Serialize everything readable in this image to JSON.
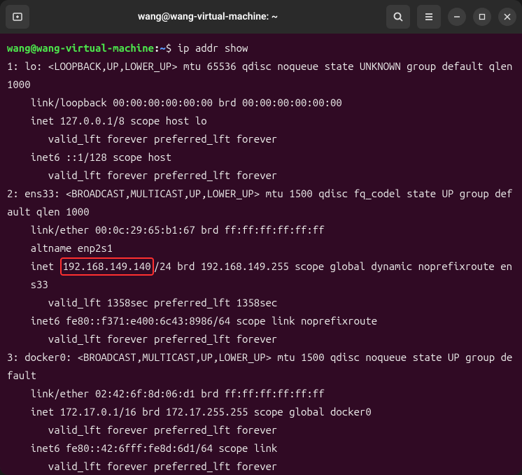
{
  "window": {
    "title": "wang@wang-virtual-machine: ~"
  },
  "prompt": {
    "user": "wang@wang-virtual-machine",
    "separator": ":",
    "path": "~",
    "symbol": "$"
  },
  "command": "ip addr show",
  "highlighted_ip": "192.168.149.140",
  "interfaces": [
    {
      "index": "1",
      "name": "lo",
      "header": "1: lo: <LOOPBACK,UP,LOWER_UP> mtu 65536 qdisc noqueue state UNKNOWN group default qlen 1000",
      "lines": [
        {
          "indent": 1,
          "text": "link/loopback 00:00:00:00:00:00 brd 00:00:00:00:00:00"
        },
        {
          "indent": 1,
          "text": "inet 127.0.0.1/8 scope host lo"
        },
        {
          "indent": 2,
          "text": "valid_lft forever preferred_lft forever"
        },
        {
          "indent": 1,
          "text": "inet6 ::1/128 scope host"
        },
        {
          "indent": 2,
          "text": "valid_lft forever preferred_lft forever"
        }
      ]
    },
    {
      "index": "2",
      "name": "ens33",
      "header": "2: ens33: <BROADCAST,MULTICAST,UP,LOWER_UP> mtu 1500 qdisc fq_codel state UP group default qlen 1000",
      "lines": [
        {
          "indent": 1,
          "text": "link/ether 00:0c:29:65:b1:67 brd ff:ff:ff:ff:ff:ff"
        },
        {
          "indent": 1,
          "text": "altname enp2s1"
        },
        {
          "indent": 1,
          "text_before": "inet ",
          "highlight": "192.168.149.140",
          "text_after": "/24 brd 192.168.149.255 scope global dynamic noprefixroute ens33"
        },
        {
          "indent": 2,
          "text": "valid_lft 1358sec preferred_lft 1358sec"
        },
        {
          "indent": 1,
          "text": "inet6 fe80::f371:e400:6c43:8986/64 scope link noprefixroute"
        },
        {
          "indent": 2,
          "text": "valid_lft forever preferred_lft forever"
        }
      ]
    },
    {
      "index": "3",
      "name": "docker0",
      "header": "3: docker0: <BROADCAST,MULTICAST,UP,LOWER_UP> mtu 1500 qdisc noqueue state UP group default",
      "lines": [
        {
          "indent": 1,
          "text": "link/ether 02:42:6f:8d:06:d1 brd ff:ff:ff:ff:ff:ff"
        },
        {
          "indent": 1,
          "text": "inet 172.17.0.1/16 brd 172.17.255.255 scope global docker0"
        },
        {
          "indent": 2,
          "text": "valid_lft forever preferred_lft forever"
        },
        {
          "indent": 1,
          "text": "inet6 fe80::42:6fff:fe8d:6d1/64 scope link"
        },
        {
          "indent": 2,
          "text": "valid_lft forever preferred_lft forever"
        }
      ]
    }
  ]
}
